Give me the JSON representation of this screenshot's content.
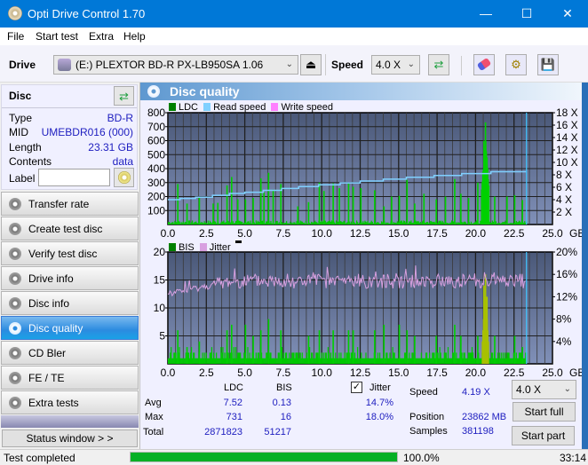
{
  "window": {
    "title": "Opti Drive Control 1.70",
    "minimize": "—",
    "maximize": "☐",
    "close": "✕"
  },
  "menu": [
    "File",
    "Start test",
    "Extra",
    "Help"
  ],
  "toolbar": {
    "drive_label": "Drive",
    "drive_value": "(E:)  PLEXTOR BD-R  PX-LB950SA 1.06",
    "speed_label": "Speed",
    "speed_value": "4.0 X",
    "icons": [
      "drive-icon",
      "eject-icon",
      "refresh-icon",
      "erase-icon",
      "settings-icon",
      "save-icon"
    ]
  },
  "disc": {
    "header": "Disc",
    "rows": [
      {
        "key": "Type",
        "value": "BD-R"
      },
      {
        "key": "MID",
        "value": "UMEBDR016 (000)"
      },
      {
        "key": "Length",
        "value": "23.31 GB"
      },
      {
        "key": "Contents",
        "value": "data"
      }
    ],
    "label_key": "Label",
    "label_value": ""
  },
  "nav": [
    {
      "label": "Transfer rate",
      "active": false
    },
    {
      "label": "Create test disc",
      "active": false
    },
    {
      "label": "Verify test disc",
      "active": false
    },
    {
      "label": "Drive info",
      "active": false
    },
    {
      "label": "Disc info",
      "active": false
    },
    {
      "label": "Disc quality",
      "active": true
    },
    {
      "label": "CD Bler",
      "active": false
    },
    {
      "label": "FE / TE",
      "active": false
    },
    {
      "label": "Extra tests",
      "active": false
    }
  ],
  "status_window_label": "Status window > >",
  "main": {
    "title": "Disc quality"
  },
  "chart_data": [
    {
      "type": "bar",
      "title": "LDC / Read speed",
      "legend": [
        "LDC",
        "Read speed",
        "Write speed"
      ],
      "colors": {
        "LDC": "#00c000",
        "Read speed": "#80d0ff",
        "Write speed": "#ff80ff"
      },
      "xlabel": "GB",
      "x_ticks": [
        "0.0",
        "2.5",
        "5.0",
        "7.5",
        "10.0",
        "12.5",
        "15.0",
        "17.5",
        "20.0",
        "22.5",
        "25.0"
      ],
      "xlim": [
        0,
        25
      ],
      "y_ticks": [
        "100",
        "200",
        "300",
        "400",
        "500",
        "600",
        "700",
        "800"
      ],
      "ylim": [
        0,
        800
      ],
      "y2_ticks": [
        "2 X",
        "4 X",
        "6 X",
        "8 X",
        "10 X",
        "12 X",
        "14 X",
        "16 X",
        "18 X"
      ],
      "y2lim": [
        0,
        18
      ],
      "ldc_peaks": [
        [
          0.6,
          290
        ],
        [
          1.2,
          150
        ],
        [
          2.0,
          195
        ],
        [
          2.9,
          150
        ],
        [
          3.2,
          155
        ],
        [
          3.8,
          280
        ],
        [
          4.1,
          340
        ],
        [
          4.5,
          180
        ],
        [
          5.0,
          180
        ],
        [
          5.5,
          190
        ],
        [
          6.0,
          330
        ],
        [
          6.2,
          230
        ],
        [
          6.5,
          370
        ],
        [
          6.8,
          250
        ],
        [
          7.3,
          290
        ],
        [
          8.4,
          130
        ],
        [
          9.1,
          160
        ],
        [
          9.8,
          300
        ],
        [
          10.1,
          240
        ],
        [
          10.7,
          295
        ],
        [
          11.1,
          260
        ],
        [
          11.7,
          300
        ],
        [
          12.0,
          270
        ],
        [
          12.5,
          260
        ],
        [
          13.4,
          245
        ],
        [
          14.0,
          130
        ],
        [
          14.5,
          200
        ],
        [
          15.0,
          205
        ],
        [
          15.5,
          320
        ],
        [
          16.0,
          150
        ],
        [
          16.6,
          220
        ],
        [
          17.4,
          180
        ],
        [
          18.0,
          200
        ],
        [
          18.6,
          325
        ],
        [
          19.0,
          220
        ],
        [
          19.5,
          190
        ],
        [
          20.1,
          300
        ],
        [
          20.5,
          600
        ],
        [
          20.6,
          731
        ],
        [
          20.7,
          480
        ],
        [
          21.2,
          200
        ],
        [
          22.0,
          200
        ],
        [
          22.5,
          210
        ],
        [
          23.0,
          175
        ]
      ],
      "read_speed": [
        [
          0,
          4.0
        ],
        [
          0.8,
          4.2
        ],
        [
          1.8,
          4.4
        ],
        [
          2.9,
          4.7
        ],
        [
          4.0,
          5.0
        ],
        [
          5.0,
          5.2
        ],
        [
          6.2,
          5.5
        ],
        [
          7.4,
          5.8
        ],
        [
          8.5,
          6.1
        ],
        [
          9.8,
          6.4
        ],
        [
          11.2,
          6.7
        ],
        [
          12.5,
          7.0
        ],
        [
          14.0,
          7.3
        ],
        [
          15.5,
          7.6
        ],
        [
          17.3,
          7.9
        ],
        [
          19.1,
          8.2
        ],
        [
          21.0,
          8.5
        ],
        [
          23.31,
          8.5
        ]
      ],
      "end_marker_gb": 23.31
    },
    {
      "type": "bar",
      "title": "BIS / Jitter",
      "legend": [
        "BIS",
        "Jitter"
      ],
      "colors": {
        "BIS": "#00c000",
        "Jitter": "#d8a0e0"
      },
      "xlabel": "GB",
      "x_ticks": [
        "0.0",
        "2.5",
        "5.0",
        "7.5",
        "10.0",
        "12.5",
        "15.0",
        "17.5",
        "20.0",
        "22.5",
        "25.0"
      ],
      "xlim": [
        0,
        25
      ],
      "y_ticks": [
        "5",
        "10",
        "15",
        "20"
      ],
      "ylim": [
        0,
        20
      ],
      "y2_ticks": [
        "4%",
        "8%",
        "12%",
        "16%",
        "20%"
      ],
      "y2lim": [
        0,
        20
      ],
      "bis_peaks": [
        [
          0.6,
          6
        ],
        [
          1.2,
          3
        ],
        [
          2.0,
          4
        ],
        [
          3.8,
          6
        ],
        [
          4.1,
          7
        ],
        [
          5.0,
          7
        ],
        [
          5.5,
          5
        ],
        [
          6.0,
          6
        ],
        [
          6.5,
          8
        ],
        [
          7.3,
          6
        ],
        [
          9.1,
          5
        ],
        [
          9.8,
          6
        ],
        [
          10.7,
          6
        ],
        [
          11.7,
          6
        ],
        [
          12.0,
          6
        ],
        [
          13.4,
          6
        ],
        [
          14.0,
          7
        ],
        [
          15.0,
          7
        ],
        [
          15.5,
          6
        ],
        [
          16.0,
          5
        ],
        [
          17.4,
          5
        ],
        [
          18.6,
          7
        ],
        [
          19.0,
          5
        ],
        [
          20.1,
          5
        ],
        [
          20.5,
          14
        ],
        [
          20.6,
          16
        ],
        [
          20.7,
          12
        ],
        [
          21.2,
          5
        ],
        [
          22.5,
          5
        ],
        [
          23.0,
          3
        ]
      ],
      "jitter_avg_pct": 14.7,
      "jitter_max_pct": 18.0,
      "end_marker_gb": 23.31
    }
  ],
  "stats": {
    "col_ldc": "LDC",
    "col_bis": "BIS",
    "jitter_checked": true,
    "jitter_label": "Jitter",
    "rows": [
      {
        "label": "Avg",
        "ldc": "7.52",
        "bis": "0.13",
        "jitter": "14.7%"
      },
      {
        "label": "Max",
        "ldc": "731",
        "bis": "16",
        "jitter": "18.0%"
      },
      {
        "label": "Total",
        "ldc": "2871823",
        "bis": "51217",
        "jitter": ""
      }
    ],
    "speed_label": "Speed",
    "speed_value": "4.19 X",
    "position_label": "Position",
    "position_value": "23862 MB",
    "samples_label": "Samples",
    "samples_value": "381198",
    "speed_select": "4.0 X",
    "start_full": "Start full",
    "start_part": "Start part"
  },
  "status": {
    "text": "Test completed",
    "progress_pct": 100.0,
    "progress_text": "100.0%",
    "elapsed": "33:14"
  }
}
